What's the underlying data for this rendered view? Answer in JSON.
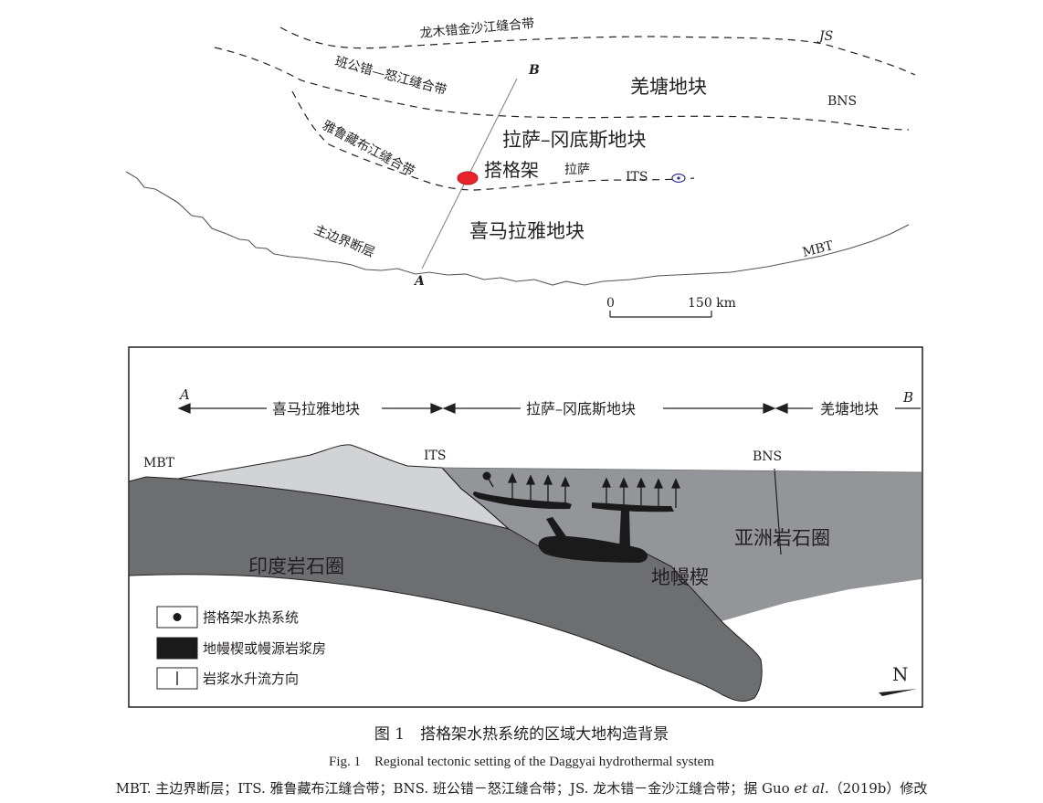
{
  "map": {
    "labels": {
      "ls_zone": "龙木错金沙江缝合带",
      "js": "JS",
      "bn_zone": "班公错—怒江缝合带",
      "qiangtang": "羌塘地块",
      "bns": "BNS",
      "point_b": "B",
      "yz_zone": "雅鲁藏布江缝合带",
      "lhasa_block": "拉萨–冈底斯地块",
      "daggyai": "搭格架",
      "lhasa_city": "拉萨",
      "its": "ITS",
      "himalaya": "喜马拉雅地块",
      "mbt_cn": "主边界断层",
      "mbt": "MBT",
      "point_a": "A"
    },
    "scale": {
      "zero": "0",
      "end": "150 km"
    }
  },
  "section": {
    "end_a": "A",
    "end_b": "B",
    "himalaya": "喜马拉雅地块",
    "lhasa": "拉萨–冈底斯地块",
    "qiangtang": "羌塘地块",
    "mbt": "MBT",
    "its": "ITS",
    "bns": "BNS",
    "asian_litho": "亚洲岩石圈",
    "indian_litho": "印度岩石圈",
    "mantle_wedge": "地幔楔",
    "north": "N",
    "legend": [
      {
        "icon": "dot",
        "label": "搭格架水热系统"
      },
      {
        "icon": "block",
        "label": "地幔楔或幔源岩浆房"
      },
      {
        "icon": "line",
        "label": "岩浆水升流方向"
      }
    ]
  },
  "caption": {
    "title_cn": "图 1　搭格架水热系统的区域大地构造背景",
    "title_en": "Fig. 1　Regional tectonic setting of the Daggyai hydrothermal system",
    "note_pre": "MBT. 主边界断层；ITS. 雅鲁藏布江缝合带；BNS. 班公错－怒江缝合带；JS. 龙木错－金沙江缝合带；据 Guo ",
    "note_italic": "et al",
    "note_post": ".（2019b）修改"
  },
  "colors": {
    "daggyai_dot": "#e8232a",
    "indian_lithosphere": "#6d6e70",
    "asian_lithosphere": "#939598",
    "himalaya_wedge": "#d1d3d4",
    "mantle_wedge": "#1a1a1a"
  }
}
